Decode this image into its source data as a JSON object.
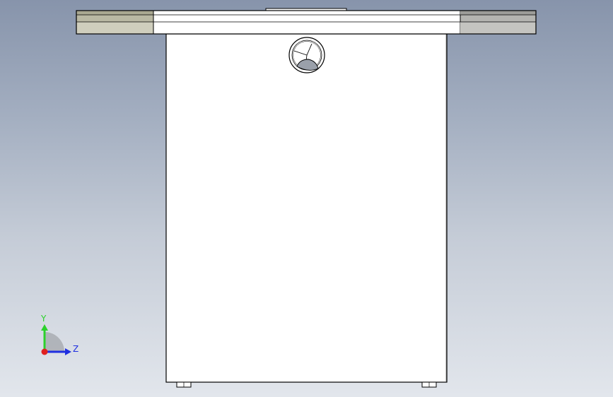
{
  "viewport": {
    "background_top": "#8794ab",
    "background_bottom": "#e2e6ec"
  },
  "model": {
    "body_fill": "#ffffff",
    "edge_color": "#000000",
    "flange_end_fill": "#c8c6b0",
    "gauge_needle_fill": "#9aa0aa"
  },
  "triad": {
    "y_label": "Y",
    "z_label": "Z",
    "y_color": "#2bd12b",
    "z_color": "#1f2fe0",
    "x_color": "#e02020"
  }
}
